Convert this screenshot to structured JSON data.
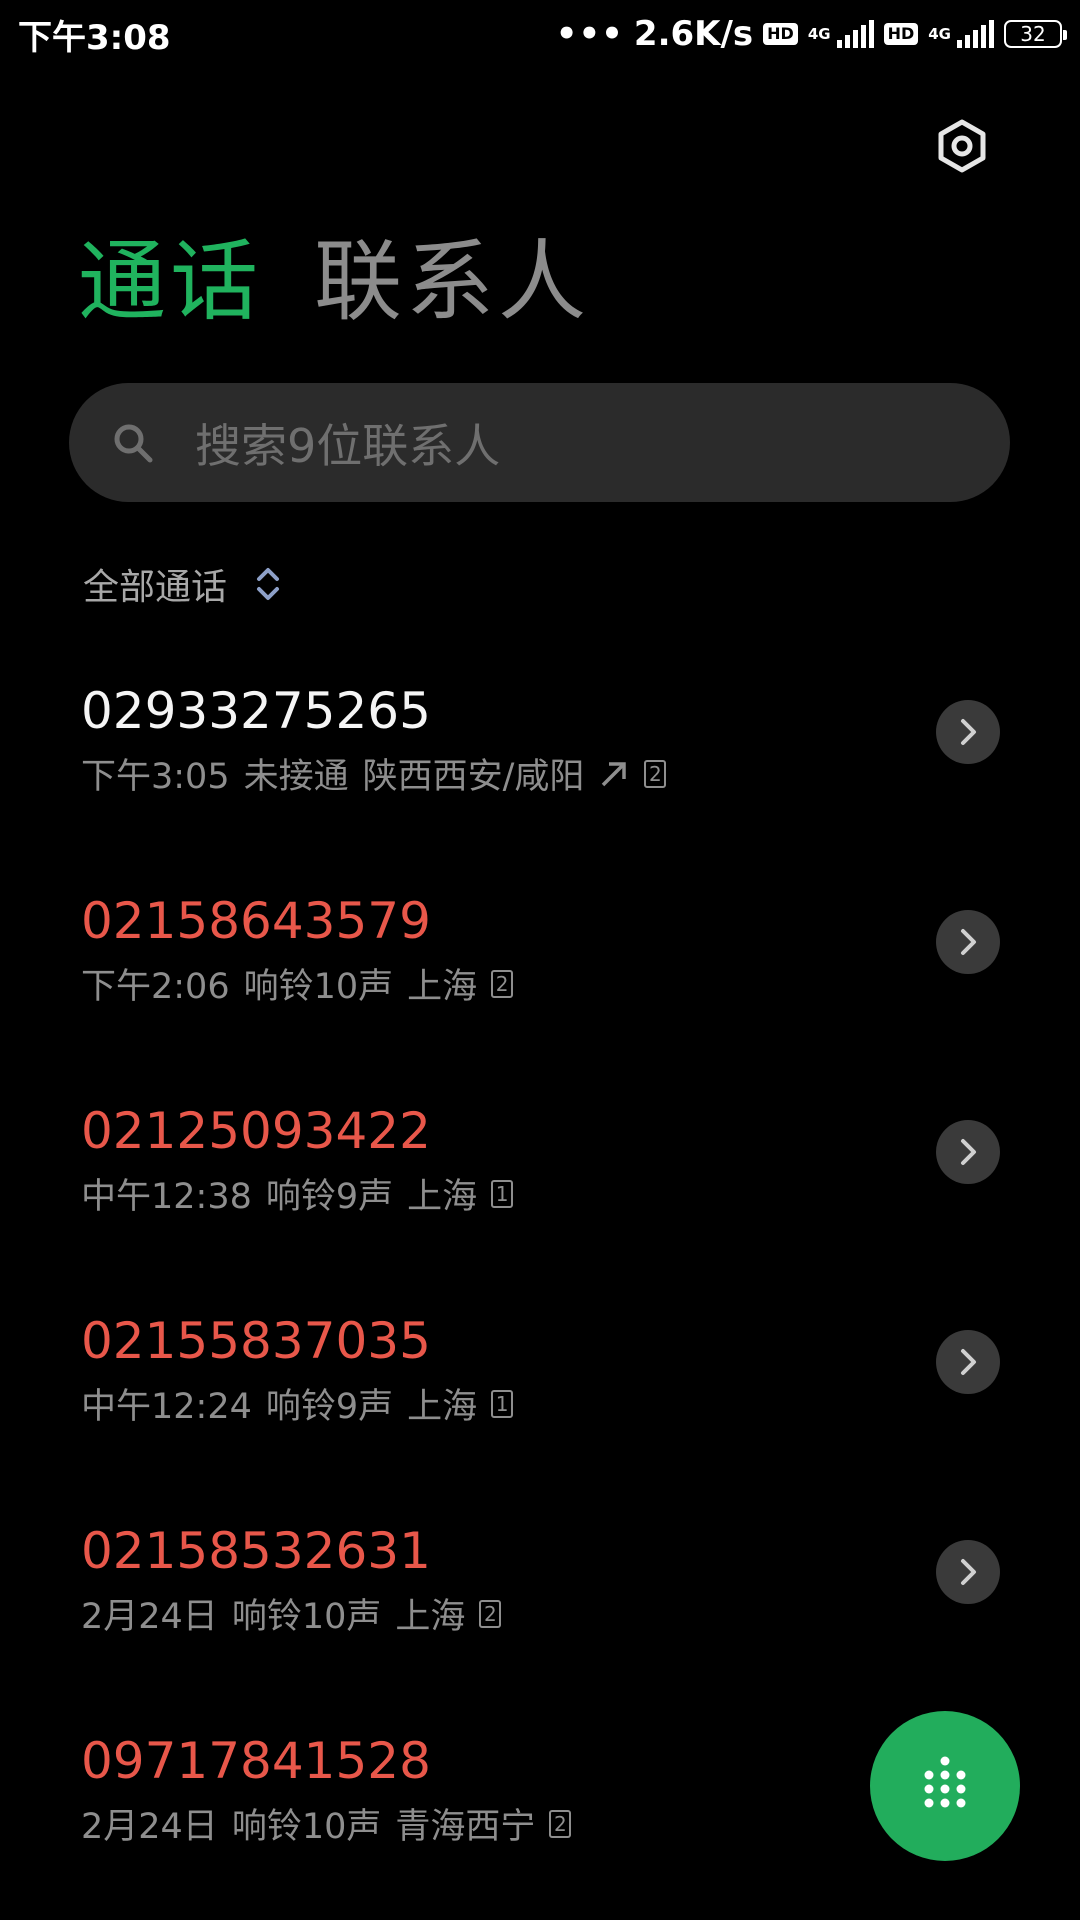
{
  "status_bar": {
    "time": "下午3:08",
    "dots": "•••",
    "net_speed": "2.6K/s",
    "hd_label": "HD",
    "network_type": "4G",
    "battery": "32"
  },
  "tabs": [
    {
      "label": "通话",
      "active": true
    },
    {
      "label": "联系人",
      "active": false
    }
  ],
  "search": {
    "placeholder": "搜索9位联系人"
  },
  "filter": {
    "label": "全部通话"
  },
  "calls": [
    {
      "number": "02933275265",
      "time": "下午3:05",
      "status": "未接通",
      "location": "陕西西安/咸阳",
      "sim": "2",
      "missed": false,
      "outgoing": true
    },
    {
      "number": "02158643579",
      "time": "下午2:06",
      "status": "响铃10声",
      "location": "上海",
      "sim": "2",
      "missed": true,
      "outgoing": false
    },
    {
      "number": "02125093422",
      "time": "中午12:38",
      "status": "响铃9声",
      "location": "上海",
      "sim": "1",
      "missed": true,
      "outgoing": false
    },
    {
      "number": "02155837035",
      "time": "中午12:24",
      "status": "响铃9声",
      "location": "上海",
      "sim": "1",
      "missed": true,
      "outgoing": false
    },
    {
      "number": "02158532631",
      "time": "2月24日",
      "status": "响铃10声",
      "location": "上海",
      "sim": "2",
      "missed": true,
      "outgoing": false
    },
    {
      "number": "09717841528",
      "time": "2月24日",
      "status": "响铃10声",
      "location": "青海西宁",
      "sim": "2",
      "missed": true,
      "outgoing": false
    }
  ],
  "colors": {
    "accent": "#20b35e",
    "missed": "#e8574a",
    "fab": "#22ad5c"
  },
  "icons": {
    "settings": "settings-hexagon-icon",
    "search": "search-icon",
    "filter_toggle": "sort-updown-icon",
    "detail": "chevron-right-icon",
    "outgoing": "outgoing-arrow-icon",
    "fab": "dialpad-icon"
  }
}
